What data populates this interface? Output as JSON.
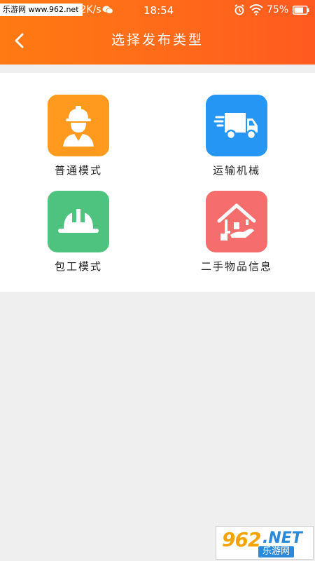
{
  "status_bar": {
    "watermark": "乐游网 www.962.net",
    "speed": ".2K/s",
    "time": "18:54",
    "battery_pct": "75%",
    "icons": [
      "wechat-icon",
      "alarm-icon",
      "wifi-icon",
      "battery-icon"
    ]
  },
  "header": {
    "title": "选择发布类型",
    "back_icon": "chevron-left-icon",
    "gradient": [
      "#ff7a12",
      "#ff5a20"
    ]
  },
  "categories": [
    {
      "label": "普通模式",
      "icon": "worker-icon",
      "color": "#ff9a1f"
    },
    {
      "label": "运输机械",
      "icon": "truck-icon",
      "color": "#2596f3"
    },
    {
      "label": "包工模式",
      "icon": "hardhat-icon",
      "color": "#4ec27f"
    },
    {
      "label": "二手物品信息",
      "icon": "house-hand-icon",
      "color": "#f56d6d"
    }
  ],
  "watermark_br": {
    "number": "962",
    "domain": ".NET",
    "site": "乐游网"
  }
}
